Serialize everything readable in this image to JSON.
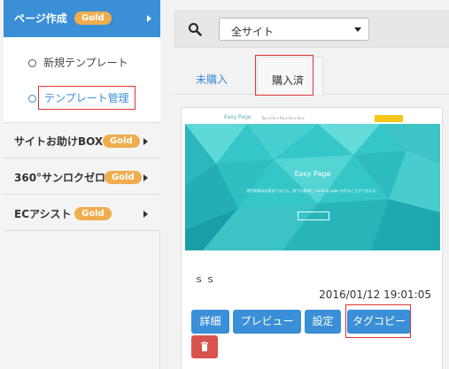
{
  "sidebar": {
    "active": {
      "label": "ページ作成",
      "badge": "Gold"
    },
    "sub_items": [
      {
        "label": "新規テンプレート"
      },
      {
        "label": "テンプレート管理"
      }
    ],
    "items": [
      {
        "label": "サイトお助けBOX",
        "badge": "Gold"
      },
      {
        "label": "360°サンロクゼロ",
        "badge": "Gold"
      },
      {
        "label": "ECアシスト",
        "badge": "Gold"
      }
    ]
  },
  "toolbar": {
    "site_select": "全サイト"
  },
  "tabs": [
    {
      "label": "未購入"
    },
    {
      "label": "購入済"
    }
  ],
  "card": {
    "thumbnail": {
      "logo": "Easy Page",
      "nav": "Top ▾   Ra ▾   Ra ▾   Ra ▾   Ra ▾",
      "title": "Easy Page",
      "subtitle": "専門知識は必要ありません。誰でも簡単に Landing page を作ることができます。"
    },
    "name": "ｓｓ",
    "date": "2016/01/12 19:01:05",
    "buttons": {
      "detail": "詳細",
      "preview": "プレビュー",
      "setting": "設定",
      "tag_copy": "タグコピー"
    }
  },
  "colors": {
    "accent": "#3a8fd6",
    "badge": "#f0ad4e",
    "danger": "#d9534f",
    "highlight_box": "#dd3333"
  }
}
